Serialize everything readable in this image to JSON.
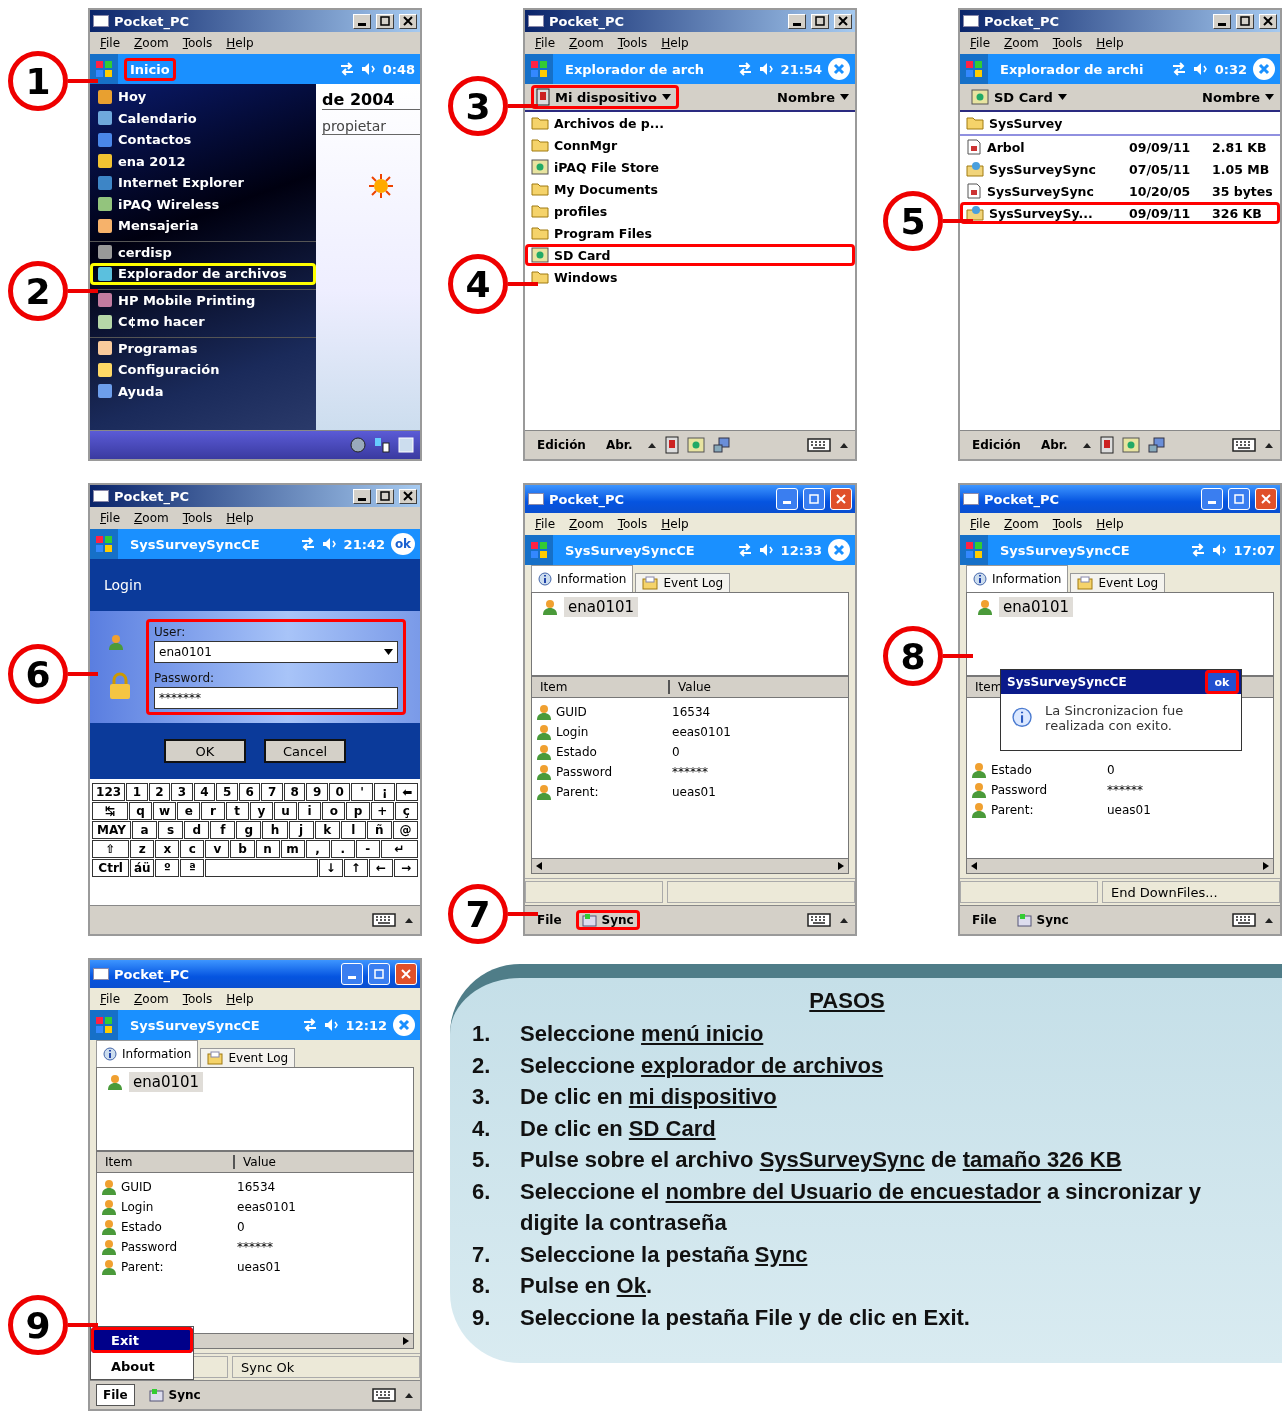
{
  "screens": [
    {
      "kind": "start_menu",
      "callouts": [
        "1",
        "2"
      ],
      "window": {
        "title": "Pocket_PC",
        "kind": "classic",
        "menu": [
          "File",
          "Zoom",
          "Tools",
          "Help"
        ]
      },
      "nav": {
        "title": "Inicio",
        "time": "0:48",
        "highlighted": true,
        "color": "#ff0000"
      },
      "start_menu": {
        "items": [
          {
            "label": "Hoy",
            "divider": false,
            "highlighted": false
          },
          {
            "label": "Calendario",
            "divider": false,
            "highlighted": false
          },
          {
            "label": "Contactos",
            "divider": false,
            "highlighted": false
          },
          {
            "label": "ena  2012",
            "divider": false,
            "highlighted": false
          },
          {
            "label": "Internet Explorer",
            "divider": false,
            "highlighted": false
          },
          {
            "label": "iPAQ Wireless",
            "divider": false,
            "highlighted": false
          },
          {
            "label": "Mensajeria",
            "divider": false,
            "highlighted": false
          },
          {
            "label": "cerdisp",
            "divider": true,
            "highlighted": false
          },
          {
            "label": "Explorador de archivos",
            "divider": false,
            "highlighted": true,
            "color": "#ffff00"
          },
          {
            "label": "HP Mobile Printing",
            "divider": true,
            "highlighted": false
          },
          {
            "label": "C¢mo hacer",
            "divider": false,
            "highlighted": false
          },
          {
            "label": "Programas",
            "divider": true,
            "highlighted": false
          },
          {
            "label": "Configuración",
            "divider": false,
            "highlighted": false
          },
          {
            "label": "Ayuda",
            "divider": false,
            "highlighted": false
          }
        ]
      },
      "today": {
        "date": "de 2004",
        "owner": "propietar"
      },
      "toolbar": {
        "kind": "today"
      }
    },
    {
      "kind": "explorer",
      "callouts": [
        "3",
        "4"
      ],
      "window": {
        "title": "Pocket_PC",
        "kind": "classic",
        "menu": [
          "File",
          "Zoom",
          "Tools",
          "Help"
        ]
      },
      "nav": {
        "title": "Explorador de arch",
        "time": "21:54",
        "close": {
          "kind": "x"
        }
      },
      "location": {
        "label": "Mi dispositivo",
        "kind": "device",
        "highlighted": true,
        "color": "#ff0000"
      },
      "sort": "Nombre",
      "files": [
        {
          "kind": "folder",
          "name": "Archivos de p...",
          "highlighted": false
        },
        {
          "kind": "folder",
          "name": "ConnMgr",
          "highlighted": false
        },
        {
          "kind": "card",
          "name": "iPAQ File Store",
          "highlighted": false
        },
        {
          "kind": "folder",
          "name": "My Documents",
          "highlighted": false
        },
        {
          "kind": "folder",
          "name": "profiles",
          "highlighted": false
        },
        {
          "kind": "folder",
          "name": "Program Files",
          "highlighted": false
        },
        {
          "kind": "card",
          "name": "SD Card",
          "highlighted": true,
          "color": "#ff0000"
        },
        {
          "kind": "folder",
          "name": "Windows",
          "highlighted": false
        }
      ],
      "toolbar": {
        "kind": "explorer",
        "items": [
          "Edición",
          "Abr."
        ]
      }
    },
    {
      "kind": "explorer",
      "callouts": [
        "5"
      ],
      "window": {
        "title": "Pocket_PC",
        "kind": "classic",
        "menu": [
          "File",
          "Zoom",
          "Tools",
          "Help"
        ]
      },
      "nav": {
        "title": "Explorador de archi",
        "time": "0:32",
        "close": {
          "kind": "x"
        }
      },
      "location": {
        "label": "SD Card",
        "kind": "card",
        "highlighted": false
      },
      "sort": "Nombre",
      "files": [
        {
          "kind": "folder",
          "name": "SysSurvey",
          "selected": true,
          "highlighted": false
        },
        {
          "kind": "file",
          "name": "Arbol",
          "date": "09/09/11",
          "size": "2.81 KB",
          "selected": false,
          "highlighted": false
        },
        {
          "kind": "package",
          "name": "SysSurveySync",
          "date": "07/05/11",
          "size": "1.05 MB",
          "selected": false,
          "highlighted": false
        },
        {
          "kind": "file",
          "name": "SysSurveySync",
          "date": "10/20/05",
          "size": "35 bytes",
          "selected": false,
          "highlighted": false
        },
        {
          "kind": "package",
          "name": "SysSurveySy...",
          "date": "09/09/11",
          "size": "326 KB",
          "selected": false,
          "highlighted": true,
          "color": "#ff0000"
        }
      ],
      "toolbar": {
        "kind": "explorer",
        "items": [
          "Edición",
          "Abr."
        ]
      }
    },
    {
      "kind": "login",
      "callouts": [
        "6"
      ],
      "window": {
        "title": "Pocket_PC",
        "kind": "classic",
        "menu": [
          "File",
          "Zoom",
          "Tools",
          "Help"
        ]
      },
      "nav": {
        "title": "SysSurveySyncCE",
        "time": "21:42",
        "close": {
          "kind": "ok",
          "label": "ok"
        }
      },
      "login": {
        "heading": "Login",
        "user_label": "User:",
        "user": "ena0101",
        "password_label": "Password:",
        "password": "*******",
        "highlighted": true,
        "color": "#ff0000",
        "buttons": [
          "OK",
          "Cancel"
        ]
      },
      "keyboard": [
        [
          "123",
          "1",
          "2",
          "3",
          "4",
          "5",
          "6",
          "7",
          "8",
          "9",
          "0",
          "'",
          "¡",
          "⬅"
        ],
        [
          "↹",
          "q",
          "w",
          "e",
          "r",
          "t",
          "y",
          "u",
          "i",
          "o",
          "p",
          "+",
          "ç"
        ],
        [
          "MAY",
          "a",
          "s",
          "d",
          "f",
          "g",
          "h",
          "j",
          "k",
          "l",
          "ñ",
          "@"
        ],
        [
          "⇧",
          "z",
          "x",
          "c",
          "v",
          "b",
          "n",
          "m",
          ",",
          ".",
          "-",
          "↵"
        ],
        [
          "Ctrl",
          "áü",
          "º",
          "ª",
          {
            "kind": "space"
          },
          "↓",
          "↑",
          "←",
          "→"
        ]
      ],
      "toolbar": {
        "kind": "keyboard"
      }
    },
    {
      "kind": "info",
      "callouts": [
        "7"
      ],
      "window": {
        "title": "Pocket_PC",
        "kind": "xp",
        "menu": [
          "File",
          "Zoom",
          "Tools",
          "Help"
        ]
      },
      "nav": {
        "title": "SysSurveySyncCE",
        "time": "12:33",
        "close": {
          "kind": "x"
        }
      },
      "tabs": [
        {
          "label": "Information",
          "selected": true
        },
        {
          "label": "Event Log",
          "selected": false
        }
      ],
      "tree": "ena0101",
      "columns": [
        "Item",
        "Value"
      ],
      "rows": [
        {
          "item": "GUID",
          "value": "16534"
        },
        {
          "item": "Login",
          "value": "eeas0101"
        },
        {
          "item": "Estado",
          "value": "0"
        },
        {
          "item": "Password",
          "value": "******"
        },
        {
          "item": "Parent:",
          "value": "ueas01"
        }
      ],
      "toolbar": {
        "kind": "tabs",
        "items": [
          {
            "label": "File",
            "selected": false,
            "highlighted": false
          },
          {
            "label": "Sync",
            "selected": false,
            "highlighted": true,
            "color": "#ff0000"
          }
        ]
      }
    },
    {
      "kind": "info",
      "callouts": [
        "8"
      ],
      "window": {
        "title": "Pocket_PC",
        "kind": "xp",
        "menu": [
          "File",
          "Zoom",
          "Tools",
          "Help"
        ]
      },
      "nav": {
        "title": "SysSurveySyncCE",
        "time": "17:07"
      },
      "tabs": [
        {
          "label": "Information",
          "selected": true
        },
        {
          "label": "Event Log",
          "selected": false
        }
      ],
      "tree": "ena0101",
      "columns": [
        "Item"
      ],
      "rows": [
        {
          "item": "Estado",
          "value": "0"
        },
        {
          "item": "Password",
          "value": "******"
        },
        {
          "item": "Parent:",
          "value": "ueas01"
        }
      ],
      "dialog": {
        "title": "SysSurveySyncCE",
        "message": "La Sincronizacion fue realizada con exito.",
        "button": "ok",
        "highlighted": true,
        "color": "#ff0000"
      },
      "status": "End DownFiles...",
      "toolbar": {
        "kind": "tabs",
        "items": [
          {
            "label": "File",
            "selected": false
          },
          {
            "label": "Sync",
            "selected": false
          }
        ]
      }
    },
    {
      "kind": "info",
      "callouts": [
        "9"
      ],
      "window": {
        "title": "Pocket_PC",
        "kind": "xp",
        "menu": [
          "File",
          "Zoom",
          "Tools",
          "Help"
        ]
      },
      "nav": {
        "title": "SysSurveySyncCE",
        "time": "12:12",
        "close": {
          "kind": "x"
        }
      },
      "tabs": [
        {
          "label": "Information",
          "selected": true
        },
        {
          "label": "Event Log",
          "selected": false
        }
      ],
      "tree": "ena0101",
      "columns": [
        "Item",
        "Value"
      ],
      "rows": [
        {
          "item": "GUID",
          "value": "16534"
        },
        {
          "item": "Login",
          "value": "eeas0101"
        },
        {
          "item": "Estado",
          "value": "0"
        },
        {
          "item": "Password",
          "value": "******"
        },
        {
          "item": "Parent:",
          "value": "ueas01"
        }
      ],
      "popup": [
        {
          "label": "Exit",
          "selected": true,
          "highlighted": true,
          "color": "#ff0000"
        },
        {
          "label": "About",
          "selected": false,
          "highlighted": false
        }
      ],
      "status": "Sync Ok",
      "toolbar": {
        "kind": "tabs",
        "items": [
          {
            "label": "File",
            "selected": true
          },
          {
            "label": "Sync",
            "selected": false
          }
        ]
      }
    }
  ],
  "steps": {
    "title": "PASOS",
    "items": [
      {
        "number": "1.",
        "segments": [
          {
            "text": "Seleccione ",
            "underline": false
          },
          {
            "text": "menú inicio",
            "underline": true
          }
        ]
      },
      {
        "number": "2.",
        "segments": [
          {
            "text": "Seleccione ",
            "underline": false
          },
          {
            "text": "explorador de archivos",
            "underline": true
          }
        ]
      },
      {
        "number": "3.",
        "segments": [
          {
            "text": "De clic en ",
            "underline": false
          },
          {
            "text": "mi dispositivo",
            "underline": true
          }
        ]
      },
      {
        "number": "4.",
        "segments": [
          {
            "text": "De clic en ",
            "underline": false
          },
          {
            "text": "SD Card",
            "underline": true
          }
        ]
      },
      {
        "number": "5.",
        "segments": [
          {
            "text": "Pulse sobre el archivo ",
            "underline": false
          },
          {
            "text": "SysSurveySync",
            "underline": true
          },
          {
            "text": " de ",
            "underline": false
          },
          {
            "text": "tamaño 326 KB",
            "underline": true
          }
        ]
      },
      {
        "number": "6.",
        "segments": [
          {
            "text": "Seleccione el ",
            "underline": false
          },
          {
            "text": "nombre del Usuario de encuestador",
            "underline": true
          },
          {
            "text": " a sincronizar y digite la contraseña",
            "underline": false
          }
        ]
      },
      {
        "number": "7.",
        "segments": [
          {
            "text": "Seleccione la pestaña ",
            "underline": false
          },
          {
            "text": "Sync",
            "underline": true
          }
        ]
      },
      {
        "number": "8.",
        "segments": [
          {
            "text": "Pulse en ",
            "underline": false
          },
          {
            "text": "Ok",
            "underline": true
          },
          {
            "text": ".",
            "underline": false
          }
        ]
      },
      {
        "number": "9.",
        "segments": [
          {
            "text": "Seleccione la pestaña File  y de clic en Exit.",
            "underline": false
          }
        ]
      }
    ]
  }
}
